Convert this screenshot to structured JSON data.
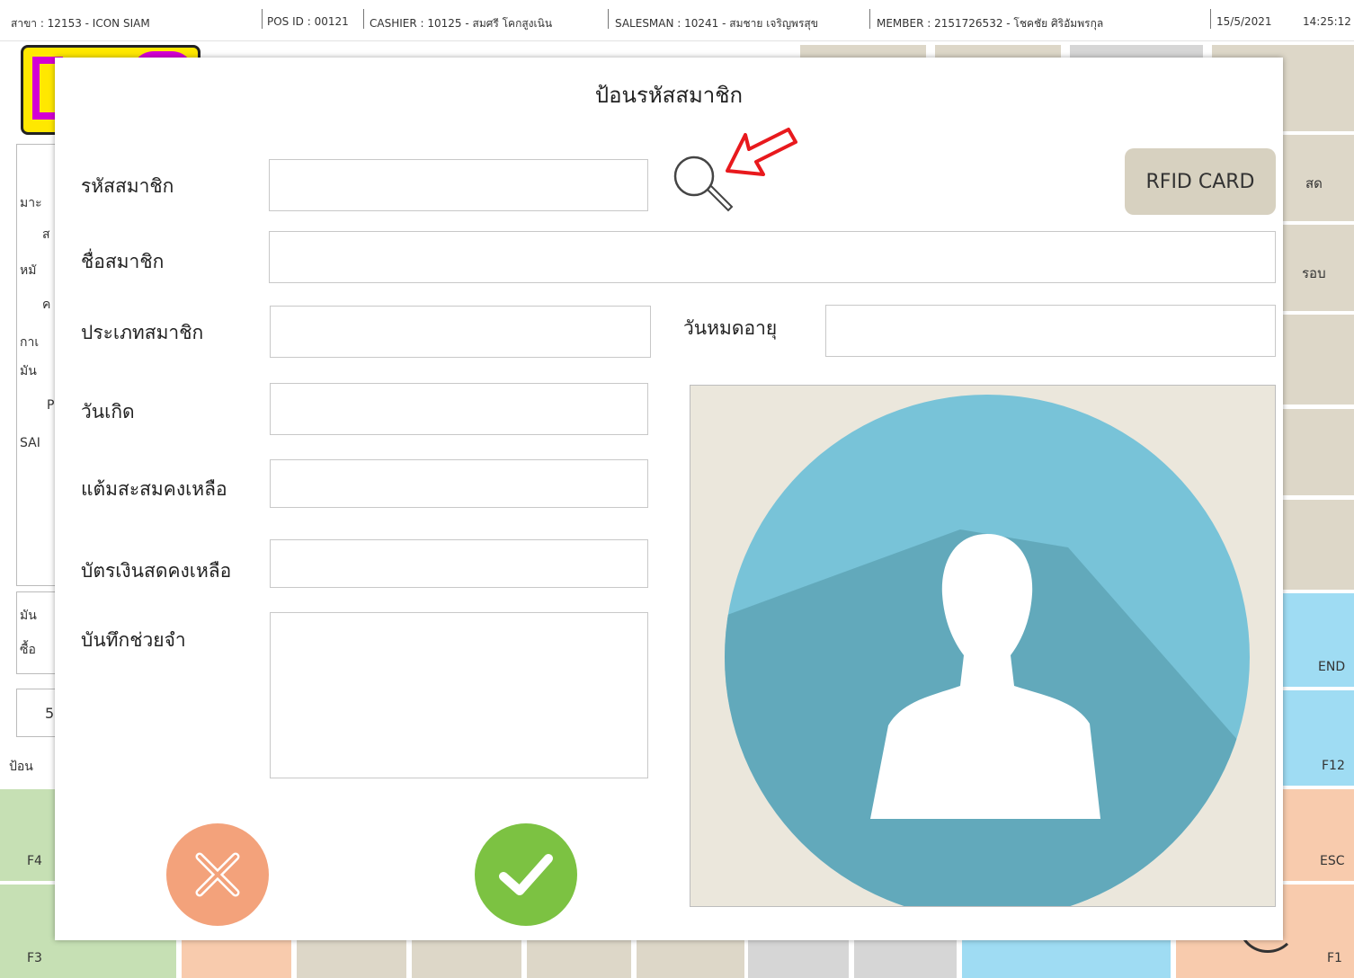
{
  "status_bar": {
    "branch": "สาขา : 12153 - ICON SIAM",
    "pos_id": "POS ID : 00121",
    "cashier": "CASHIER : 10125 - สมศรี โคกสูงเนิน",
    "salesman": "SALESMAN : 10241 - สมชาย เจริญพรสุข",
    "member": "MEMBER : 2151726532 - โชคชัย ศิริอัมพรกุล",
    "date": "15/5/2021",
    "time": "14:25:12"
  },
  "background": {
    "left_partial_labels": [
      "มาะ",
      "ส",
      "หมั",
      "ค",
      "กาเ",
      "มัน",
      "P",
      "SAI",
      "มัน",
      "ซื้อ",
      "5",
      "ป้อน"
    ],
    "right_partial_labels": [
      "สด",
      "รอบ"
    ],
    "function_keys": [
      "END",
      "F12",
      "ESC",
      "F1",
      "F4",
      "F3"
    ]
  },
  "modal": {
    "title": "ป้อนรหัสสมาชิก",
    "fields": {
      "member_code": {
        "label": "รหัสสมาชิก",
        "value": ""
      },
      "member_name": {
        "label": "ชื่อสมาชิก",
        "value": ""
      },
      "member_type": {
        "label": "ประเภทสมาชิก",
        "value": ""
      },
      "expiry_date": {
        "label": "วันหมดอายุ",
        "value": ""
      },
      "birth_date": {
        "label": "วันเกิด",
        "value": ""
      },
      "points_balance": {
        "label": "แต้มสะสมคงเหลือ",
        "value": ""
      },
      "cash_card_balance": {
        "label": "บัตรเงินสดคงเหลือ",
        "value": ""
      },
      "memo": {
        "label": "บันทึกช่วยจำ",
        "value": ""
      }
    },
    "rfid_button": "RFID CARD",
    "icons": {
      "search": "search-icon",
      "arrow": "red-arrow-icon",
      "avatar": "avatar-placeholder-icon",
      "cancel": "close-icon",
      "confirm": "check-icon"
    },
    "colors": {
      "arrow": "#e8191d",
      "avatar_circle": "#78c3d8",
      "cancel": "#f3a27b",
      "confirm": "#7cc242"
    }
  }
}
